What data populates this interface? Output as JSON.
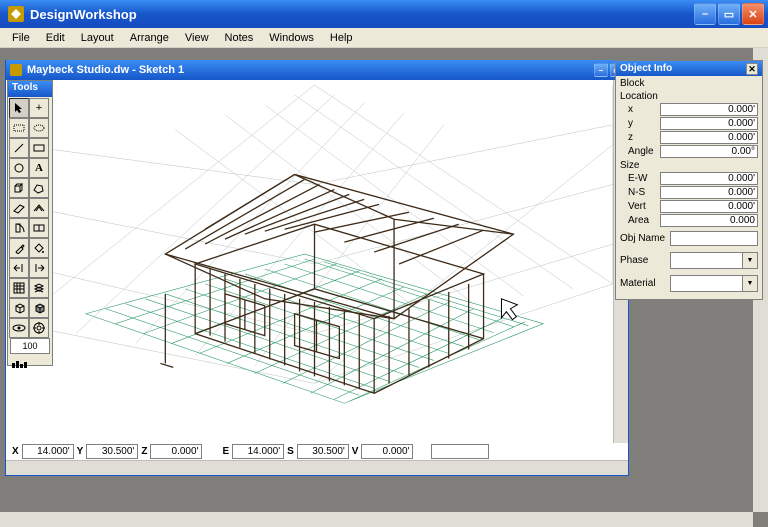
{
  "app": {
    "title": "DesignWorkshop"
  },
  "menu": {
    "items": [
      "File",
      "Edit",
      "Layout",
      "Arrange",
      "View",
      "Notes",
      "Windows",
      "Help"
    ]
  },
  "doc": {
    "title": "Maybeck Studio.dw - Sketch 1"
  },
  "toolbox": {
    "title": "Tools",
    "spinner": "100"
  },
  "status": {
    "x_lbl": "X",
    "x": "14.000'",
    "y_lbl": "Y",
    "y": "30.500'",
    "z_lbl": "Z",
    "z": "0.000'",
    "e_lbl": "E",
    "e": "14.000'",
    "s_lbl": "S",
    "s": "30.500'",
    "v_lbl": "V",
    "v": "0.000'"
  },
  "info": {
    "title": "Object Info",
    "block": "Block",
    "location": "Location",
    "x_lbl": "x",
    "x": "0.000'",
    "y_lbl": "y",
    "y": "0.000'",
    "z_lbl": "z",
    "z": "0.000'",
    "angle_lbl": "Angle",
    "angle": "0.00°",
    "size": "Size",
    "ew_lbl": "E-W",
    "ew": "0.000'",
    "ns_lbl": "N-S",
    "ns": "0.000'",
    "vert_lbl": "Vert",
    "vert": "0.000'",
    "area_lbl": "Area",
    "area": "0.000",
    "objname_lbl": "Obj Name",
    "objname": "",
    "phase_lbl": "Phase",
    "phase": "",
    "material_lbl": "Material",
    "material": ""
  }
}
